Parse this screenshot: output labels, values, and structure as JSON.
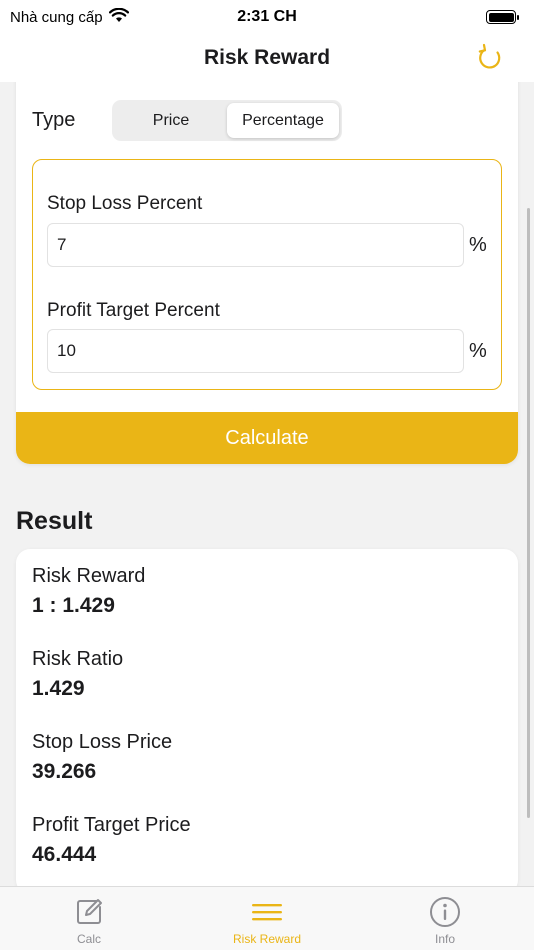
{
  "status_bar": {
    "carrier": "Nhà cung cấp",
    "time": "2:31 CH"
  },
  "nav": {
    "title": "Risk Reward",
    "refresh_icon": "refresh-icon"
  },
  "form": {
    "type_label": "Type",
    "type_options": [
      "Price",
      "Percentage"
    ],
    "type_selected": "Percentage",
    "stop_loss_label": "Stop Loss Percent",
    "stop_loss_value": "7",
    "profit_target_label": "Profit Target Percent",
    "profit_target_value": "10",
    "unit": "%",
    "calculate_label": "Calculate"
  },
  "result": {
    "heading": "Result",
    "items": [
      {
        "label": "Risk Reward",
        "value": "1 : 1.429"
      },
      {
        "label": "Risk Ratio",
        "value": "1.429"
      },
      {
        "label": "Stop Loss Price",
        "value": "39.266"
      },
      {
        "label": "Profit Target Price",
        "value": "46.444"
      }
    ]
  },
  "tabs": [
    {
      "label": "Calc",
      "icon": "edit-icon",
      "active": false
    },
    {
      "label": "Risk Reward",
      "icon": "menu-icon",
      "active": true
    },
    {
      "label": "Info",
      "icon": "info-icon",
      "active": false
    }
  ],
  "colors": {
    "accent": "#eab516",
    "inactive": "#8e8e93",
    "background": "#f2f2f2"
  }
}
